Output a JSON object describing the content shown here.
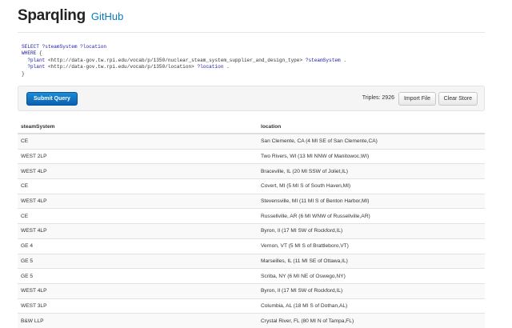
{
  "header": {
    "brand": "Sparqling",
    "github_link": "GitHub"
  },
  "query": {
    "line1": {
      "kw": "SELECT",
      "vars": "?steamSystem ?location"
    },
    "line2": {
      "kw": "WHERE",
      "rest": "{"
    },
    "line3": {
      "subj": "?plant",
      "iri": "<http://data-gov.tw.rpi.edu/vocab/p/1350/nuclear_steam_system_supplier_and_design_type>",
      "obj": "?steamSystem",
      "end": "."
    },
    "line4": {
      "subj": "?plant",
      "iri": "<http://data-gov.tw.rpi.edu/vocab/p/1350/location>",
      "obj": "?location",
      "end": "."
    },
    "line5": "}"
  },
  "toolbar": {
    "submit_label": "Submit Query",
    "triples_text": "Triples: 2926",
    "import_label": "Import File",
    "clear_label": "Clear Store"
  },
  "table": {
    "headers": [
      "steamSystem",
      "location"
    ],
    "rows": [
      [
        "CE",
        "San Clemente, CA (4 MI SE of San Clemente,CA)"
      ],
      [
        "WEST 2LP",
        "Two Rivers, WI (13 MI NNW of Manitowoc,WI)"
      ],
      [
        "WEST 4LP",
        "Braceville, IL (20 MI SSW of Joliet,IL)"
      ],
      [
        "CE",
        "Covert, MI (5 MI S of South Haven,MI)"
      ],
      [
        "WEST 4LP",
        "Stevensville, MI (11 MI S of Benton Harbor,MI)"
      ],
      [
        "CE",
        "Russellville, AR (6 MI WNW of Russellville,AR)"
      ],
      [
        "WEST 4LP",
        "Byron, Il (17 MI SW of Rockford,IL)"
      ],
      [
        "GE 4",
        "Vernon, VT (5 MI S of Brattleboro,VT)"
      ],
      [
        "GE 5",
        "Marseilles, IL (11 MI SE of Ottawa,IL)"
      ],
      [
        "GE 5",
        "Scriba, NY (6 MI NE of Oswego,NY)"
      ],
      [
        "WEST 4LP",
        "Byron, Il (17 MI SW of Rockford,IL)"
      ],
      [
        "WEST 3LP",
        "Columbia, AL (18 MI S of Dothan,AL)"
      ],
      [
        "B&W LLP",
        "Crystal River, FL (80 MI N of Tampa,FL)"
      ]
    ]
  }
}
